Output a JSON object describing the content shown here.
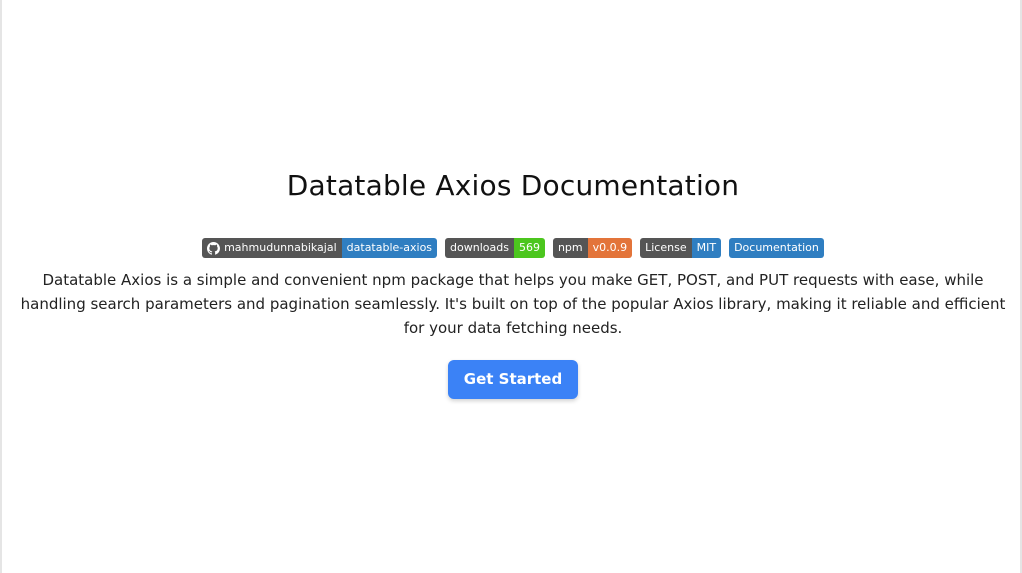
{
  "page": {
    "title": "Datatable Axios Documentation",
    "description": "Datatable Axios is a simple and convenient npm package that helps you make GET, POST, and PUT requests with ease, while handling search parameters and pagination seamlessly. It's built on top of the popular Axios library, making it reliable and efficient for your data fetching needs.",
    "cta_label": "Get Started"
  },
  "badges": [
    {
      "name": "github",
      "icon": "github-icon",
      "left": "mahmudunnabikajal",
      "right": "datatable-axios",
      "right_color": "#2f7ec1"
    },
    {
      "name": "downloads",
      "left": "downloads",
      "right": "569",
      "right_color": "#4cc61e"
    },
    {
      "name": "npm-version",
      "left": "npm",
      "right": "v0.0.9",
      "right_color": "#e3743a"
    },
    {
      "name": "license",
      "left": "License",
      "right": "MIT",
      "right_color": "#2f7ec1"
    },
    {
      "name": "documentation",
      "left": "",
      "right": "Documentation",
      "right_color": "#2f7ec1"
    }
  ],
  "colors": {
    "badge_left": "#555555",
    "cta_background": "#3b82f6"
  }
}
